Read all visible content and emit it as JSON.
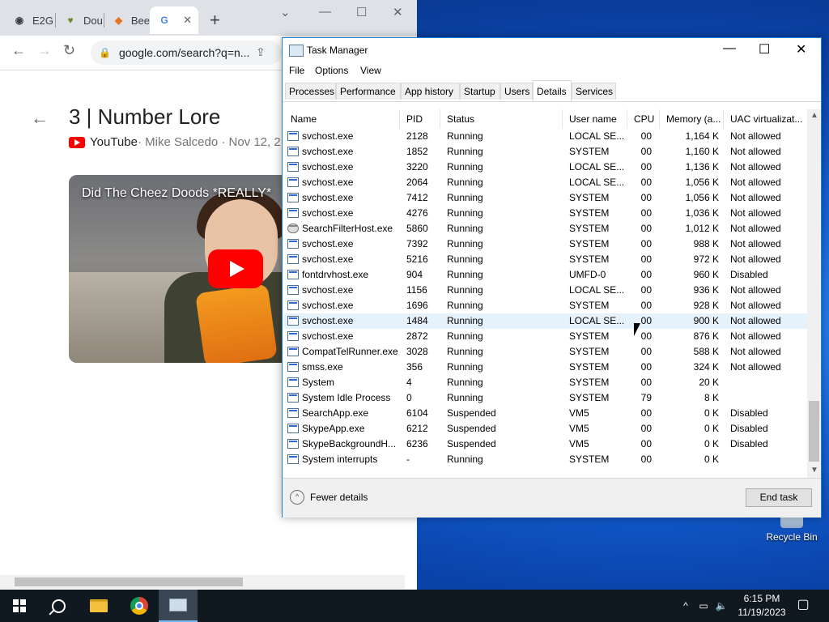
{
  "desktop": {
    "recycle_bin_label": "Recycle Bin"
  },
  "chrome": {
    "tabs": [
      {
        "label": "E2G",
        "favicon": "globe-icon"
      },
      {
        "label": "Dou",
        "favicon": "douglas-icon"
      },
      {
        "label": "Bee",
        "favicon": "bee-icon"
      },
      {
        "label": "G",
        "favicon": "google-icon",
        "active": true
      }
    ],
    "new_tab_glyph": "+",
    "url": "google.com/search?q=n...",
    "page": {
      "video_title": "3 | Number Lore",
      "source": "YouTube",
      "meta": " · Mike Salcedo · Nov 12, 2",
      "thumbnail_title": "Did The Cheez Doods *REALLY*"
    }
  },
  "taskmgr": {
    "title": "Task Manager",
    "menu": [
      "File",
      "Options",
      "View"
    ],
    "tabs": [
      "Processes",
      "Performance",
      "App history",
      "Startup",
      "Users",
      "Details",
      "Services"
    ],
    "active_tab": "Details",
    "columns": [
      "Name",
      "PID",
      "Status",
      "User name",
      "CPU",
      "Memory (a...",
      "UAC virtualizat..."
    ],
    "rows": [
      {
        "name": "svchost.exe",
        "pid": "2128",
        "status": "Running",
        "user": "LOCAL SE...",
        "cpu": "00",
        "mem": "1,164 K",
        "uac": "Not allowed"
      },
      {
        "name": "svchost.exe",
        "pid": "1852",
        "status": "Running",
        "user": "SYSTEM",
        "cpu": "00",
        "mem": "1,160 K",
        "uac": "Not allowed"
      },
      {
        "name": "svchost.exe",
        "pid": "3220",
        "status": "Running",
        "user": "LOCAL SE...",
        "cpu": "00",
        "mem": "1,136 K",
        "uac": "Not allowed"
      },
      {
        "name": "svchost.exe",
        "pid": "2064",
        "status": "Running",
        "user": "LOCAL SE...",
        "cpu": "00",
        "mem": "1,056 K",
        "uac": "Not allowed"
      },
      {
        "name": "svchost.exe",
        "pid": "7412",
        "status": "Running",
        "user": "SYSTEM",
        "cpu": "00",
        "mem": "1,056 K",
        "uac": "Not allowed"
      },
      {
        "name": "svchost.exe",
        "pid": "4276",
        "status": "Running",
        "user": "SYSTEM",
        "cpu": "00",
        "mem": "1,036 K",
        "uac": "Not allowed"
      },
      {
        "name": "SearchFilterHost.exe",
        "pid": "5860",
        "status": "Running",
        "user": "SYSTEM",
        "cpu": "00",
        "mem": "1,012 K",
        "uac": "Not allowed",
        "icon": "search"
      },
      {
        "name": "svchost.exe",
        "pid": "7392",
        "status": "Running",
        "user": "SYSTEM",
        "cpu": "00",
        "mem": "988 K",
        "uac": "Not allowed"
      },
      {
        "name": "svchost.exe",
        "pid": "5216",
        "status": "Running",
        "user": "SYSTEM",
        "cpu": "00",
        "mem": "972 K",
        "uac": "Not allowed"
      },
      {
        "name": "fontdrvhost.exe",
        "pid": "904",
        "status": "Running",
        "user": "UMFD-0",
        "cpu": "00",
        "mem": "960 K",
        "uac": "Disabled"
      },
      {
        "name": "svchost.exe",
        "pid": "1156",
        "status": "Running",
        "user": "LOCAL SE...",
        "cpu": "00",
        "mem": "936 K",
        "uac": "Not allowed"
      },
      {
        "name": "svchost.exe",
        "pid": "1696",
        "status": "Running",
        "user": "SYSTEM",
        "cpu": "00",
        "mem": "928 K",
        "uac": "Not allowed"
      },
      {
        "name": "svchost.exe",
        "pid": "1484",
        "status": "Running",
        "user": "LOCAL SE...",
        "cpu": "00",
        "mem": "900 K",
        "uac": "Not allowed",
        "selected": true
      },
      {
        "name": "svchost.exe",
        "pid": "2872",
        "status": "Running",
        "user": "SYSTEM",
        "cpu": "00",
        "mem": "876 K",
        "uac": "Not allowed"
      },
      {
        "name": "CompatTelRunner.exe",
        "pid": "3028",
        "status": "Running",
        "user": "SYSTEM",
        "cpu": "00",
        "mem": "588 K",
        "uac": "Not allowed"
      },
      {
        "name": "smss.exe",
        "pid": "356",
        "status": "Running",
        "user": "SYSTEM",
        "cpu": "00",
        "mem": "324 K",
        "uac": "Not allowed"
      },
      {
        "name": "System",
        "pid": "4",
        "status": "Running",
        "user": "SYSTEM",
        "cpu": "00",
        "mem": "20 K",
        "uac": ""
      },
      {
        "name": "System Idle Process",
        "pid": "0",
        "status": "Running",
        "user": "SYSTEM",
        "cpu": "79",
        "mem": "8 K",
        "uac": ""
      },
      {
        "name": "SearchApp.exe",
        "pid": "6104",
        "status": "Suspended",
        "user": "VM5",
        "cpu": "00",
        "mem": "0 K",
        "uac": "Disabled"
      },
      {
        "name": "SkypeApp.exe",
        "pid": "6212",
        "status": "Suspended",
        "user": "VM5",
        "cpu": "00",
        "mem": "0 K",
        "uac": "Disabled"
      },
      {
        "name": "SkypeBackgroundH...",
        "pid": "6236",
        "status": "Suspended",
        "user": "VM5",
        "cpu": "00",
        "mem": "0 K",
        "uac": "Disabled"
      },
      {
        "name": "System interrupts",
        "pid": "-",
        "status": "Running",
        "user": "SYSTEM",
        "cpu": "00",
        "mem": "0 K",
        "uac": ""
      }
    ],
    "fewer_details": "Fewer details",
    "end_task": "End task"
  },
  "taskbar": {
    "time": "6:15 PM",
    "date": "11/19/2023"
  }
}
